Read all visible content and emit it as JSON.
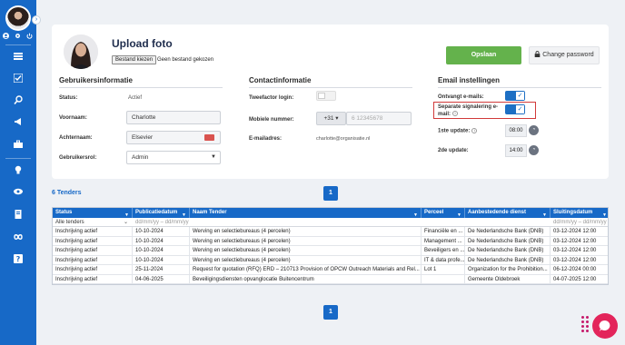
{
  "colors": {
    "sidebar": "#1769c7",
    "accent": "#1769c7",
    "save": "#64b24c",
    "highlight": "#d13a3a"
  },
  "sidebar": {
    "icons": [
      "dashboard-icon",
      "checklist-icon",
      "search-icon",
      "megaphone-icon",
      "briefcase-icon",
      "lightbulb-icon",
      "eye-icon",
      "document-icon",
      "infinity-icon",
      "help-icon"
    ]
  },
  "header": {
    "title": "Upload foto",
    "file_button": "Bestand kiezen",
    "file_status": "Geen bestand gekozen",
    "save_label": "Opslaan",
    "change_password_label": "Change password"
  },
  "user_info": {
    "title": "Gebruikersinformatie",
    "status_label": "Status:",
    "status_value": "Actief",
    "first_name_label": "Voornaam:",
    "first_name": "Charlotte",
    "last_name_label": "Achternaam:",
    "last_name": "Elsevier",
    "role_label": "Gebruikersrol:",
    "role": "Admin"
  },
  "contact": {
    "title": "Contactinformatie",
    "two_factor_label": "Tweefactor login:",
    "two_factor_on": false,
    "mobile_label": "Mobiele nummer:",
    "country_code": "+31",
    "mobile_placeholder": "6 12345678",
    "email_label": "E-mailadres:",
    "email": "charlotte@organisatie.nl"
  },
  "email_settings": {
    "title": "Email instellingen",
    "receive_label": "Ontvangt e-mails:",
    "receive_on": true,
    "separate_label": "Separate signalering e-mail:",
    "separate_on": true,
    "first_update_label": "1ste update:",
    "first_update_time": "08:00",
    "second_update_label": "2de update:",
    "second_update_time": "14:00"
  },
  "tenders": {
    "count_label": "6 Tenders",
    "page": "1",
    "columns": [
      "Status",
      "Publicatiedatum",
      "Naam Tender",
      "Perceel",
      "Aanbestedende dienst",
      "Sluitingsdatum"
    ],
    "filter": {
      "status": "Alle tenders",
      "date_placeholder": "dd/mm/yy – dd/mm/yy",
      "date_placeholder_end": "dd/mm/yy – dd/mm/yy"
    },
    "rows": [
      [
        "Inschrijving actief",
        "10-10-2024",
        "Werving en selectiebureaus (4 percelen)",
        "Financiële en ...",
        "De Nederlandsche Bank (DNB)",
        "03-12-2024 12:00"
      ],
      [
        "Inschrijving actief",
        "10-10-2024",
        "Werving en selectiebureaus (4 percelen)",
        "Management ...",
        "De Nederlandsche Bank (DNB)",
        "03-12-2024 12:00"
      ],
      [
        "Inschrijving actief",
        "10-10-2024",
        "Werving en selectiebureaus (4 percelen)",
        "Beveiligers en ...",
        "De Nederlandsche Bank (DNB)",
        "03-12-2024 12:00"
      ],
      [
        "Inschrijving actief",
        "10-10-2024",
        "Werving en selectiebureaus (4 percelen)",
        "IT & data profe...",
        "De Nederlandsche Bank (DNB)",
        "03-12-2024 12:00"
      ],
      [
        "Inschrijving actief",
        "25-11-2024",
        "Request for quotation (RFQ) ERD – 210713 Provision of OPCW Outreach Materials and Rel...",
        "Lot 1",
        "Organization for the Prohibition...",
        "06-12-2024 00:00"
      ],
      [
        "Inschrijving actief",
        "04-06-2025",
        "Beveiligingsdiensten opvanglocatie Buitencentrum",
        "",
        "Gemeente Oldebroek",
        "04-07-2025 12:00"
      ]
    ]
  }
}
